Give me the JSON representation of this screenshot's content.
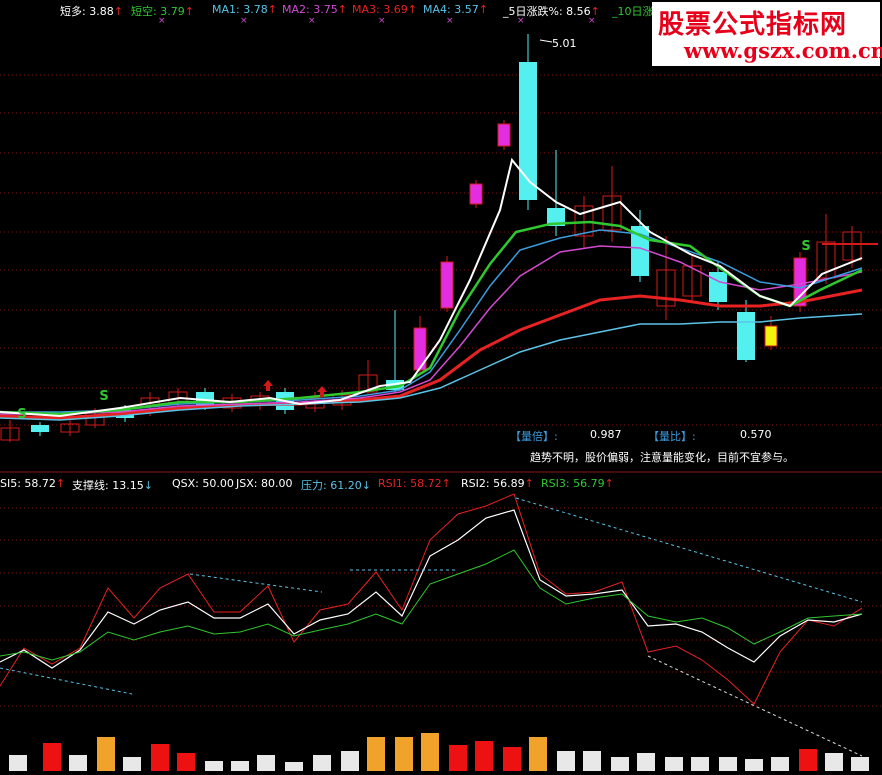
{
  "colors": {
    "background": "#000000",
    "grid": "#7a1010",
    "separator": "#8a1414",
    "up_candle": "#d21a1a",
    "down_candle": "#54f0ef",
    "doji_magenta": "#e22ee0",
    "doji_yellow": "#f2f20c",
    "line_white": "#ffffff",
    "line_green": "#2fc82f",
    "line_blue": "#3a9de0",
    "line_magenta": "#d24ad0",
    "line_red": "#e62222",
    "line_cyan": "#5bc3e6",
    "volume_red": "#ee1111",
    "volume_white": "#e8e8e8",
    "volume_orange": "#f0a22a"
  },
  "price_legend": [
    {
      "label": "短多: 3.88",
      "color": "#ffffff"
    },
    {
      "label": "短空: 3.79",
      "color": "#2fc82f"
    },
    {
      "label": "MA1: 3.78",
      "color": "#5bc3e6"
    },
    {
      "label": "MA2: 3.75",
      "color": "#d24ad0"
    },
    {
      "label": "MA3: 3.69",
      "color": "#e62222"
    },
    {
      "label": "MA4: 3.57",
      "color": "#5bc3e6"
    },
    {
      "label": "_5日涨跌%: 8.56",
      "color": "#ffffff"
    },
    {
      "label": "_10日涨",
      "color": "#2fc82f"
    }
  ],
  "up_arrow": "↑",
  "down_arrow": "↓",
  "cross_mark": "×",
  "watermark": {
    "title": "股票公式指标网",
    "url": "www.gszx.com.cn"
  },
  "price_annotations": {
    "peak_value": "5.01",
    "signal_letter": "S"
  },
  "info_panel": {
    "volume_ratio_label": "【量倍】:",
    "volume_ratio_value": "0.987",
    "quantity_ratio_label": "【量比】:",
    "quantity_ratio_value": "0.570",
    "advice": "趋势不明，股价偏弱，注意量能变化，目前不宜参与。"
  },
  "rsi_legend": [
    {
      "label": "SI5: 58.72",
      "color": "#ffffff",
      "arrow": "↑"
    },
    {
      "label": "支撑线: 13.15",
      "color": "#ffffff",
      "arrow": "↓"
    },
    {
      "label": "QSX: 50.00",
      "color": "#ffffff",
      "arrow": ""
    },
    {
      "label": "JSX: 80.00",
      "color": "#ffffff",
      "arrow": ""
    },
    {
      "label": "压力: 61.20",
      "color": "#5bc3e6",
      "arrow": "↓"
    },
    {
      "label": "RSI1: 58.72",
      "color": "#e62222",
      "arrow": "↑"
    },
    {
      "label": "RSI2: 56.89",
      "color": "#ffffff",
      "arrow": "↑"
    },
    {
      "label": "RSI3: 56.79",
      "color": "#2fc82f",
      "arrow": "↑"
    }
  ]
}
